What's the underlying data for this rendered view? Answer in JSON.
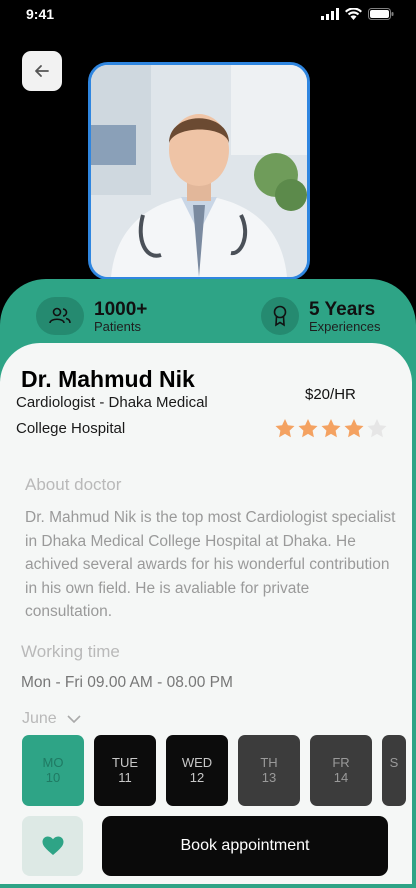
{
  "status_bar": {
    "time": "9:41"
  },
  "stats": [
    {
      "value": "1000+",
      "label": "Patients",
      "icon": "people-icon"
    },
    {
      "value": "5 Years",
      "label": "Experiences",
      "icon": "award-icon"
    }
  ],
  "doctor": {
    "name": "Dr. Mahmud Nik",
    "specialty": "Cardiologist - Dhaka Medical College Hospital",
    "price": "$20/HR",
    "rating": 4,
    "rating_max": 5
  },
  "about": {
    "title": "About doctor",
    "text": "Dr. Mahmud Nik is the top most Cardiologist specialist in Dhaka Medical College Hospital at Dhaka. He achived several awards for his wonderful contribution in his own field. He is avaliable for private consultation."
  },
  "working": {
    "title": "Working time",
    "hours": "Mon - Fri 09.00 AM - 08.00 PM"
  },
  "calendar": {
    "month": "June",
    "days": [
      {
        "day": "MO",
        "date": "10"
      },
      {
        "day": "TUE",
        "date": "11"
      },
      {
        "day": "WED",
        "date": "12"
      },
      {
        "day": "TH",
        "date": "13"
      },
      {
        "day": "FR",
        "date": "14"
      },
      {
        "day": "S",
        "date": ""
      }
    ]
  },
  "actions": {
    "book_label": "Book appointment"
  },
  "colors": {
    "primary": "#2ea486",
    "photo_border": "#2f86e0",
    "star": "#f4a261",
    "dark": "#0a0a0a"
  }
}
